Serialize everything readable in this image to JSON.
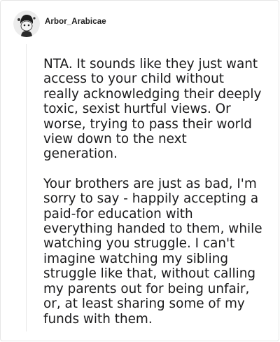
{
  "comment": {
    "username": "Arbor_Arabicae",
    "avatar_icon": "snoo-avatar-icon",
    "paragraphs": [
      "NTA. It sounds like they just want\naccess to your child without\nreally acknowledging their deeply\ntoxic, sexist hurtful views. Or\nworse, trying to pass their world\nview down to the next\ngeneration.",
      "Your brothers are just as bad, I'm\nsorry to say - happily accepting a\npaid-for education with\neverything handed to them, while\nwatching you struggle. I can't\nimagine watching my sibling\nstruggle like that, without calling\nmy parents out for being unfair,\nor, at least sharing some of my\nfunds with them."
    ]
  },
  "colors": {
    "text": "#1a1a1b",
    "border": "#e6e6e6",
    "thread_line": "#e8e8e8"
  }
}
